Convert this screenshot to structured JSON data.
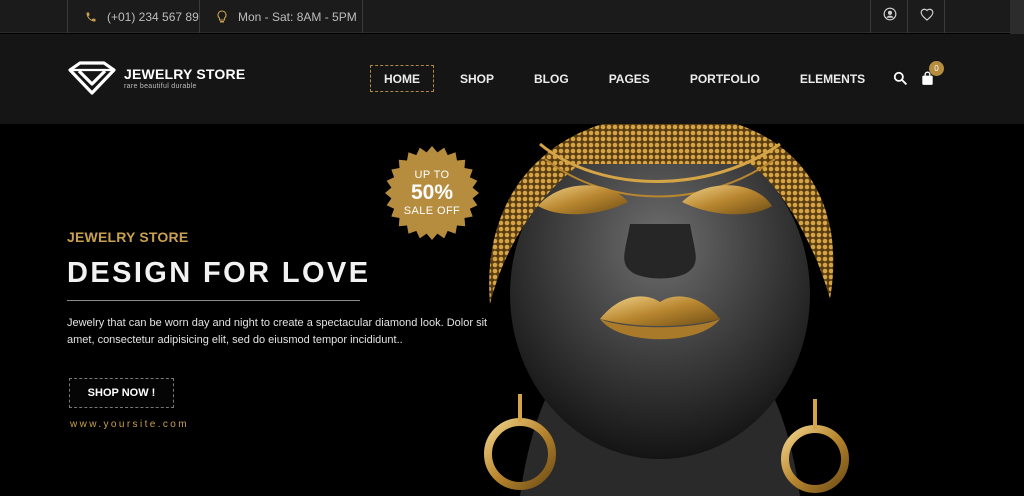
{
  "topbar": {
    "phone": "(+01) 234 567 89",
    "hours": "Mon - Sat: 8AM - 5PM",
    "phone_icon": "phone-icon",
    "hours_icon": "lightbulb-icon",
    "account_icon": "user-icon",
    "wishlist_icon": "heart-icon"
  },
  "brand": {
    "name": "JEWELRY STORE",
    "tagline": "rare beautiful durable",
    "logo_icon": "diamond-logo-icon"
  },
  "nav": {
    "items": [
      {
        "label": "HOME",
        "active": true
      },
      {
        "label": "SHOP",
        "active": false
      },
      {
        "label": "BLOG",
        "active": false
      },
      {
        "label": "PAGES",
        "active": false
      },
      {
        "label": "PORTFOLIO",
        "active": false
      },
      {
        "label": "ELEMENTS",
        "active": false
      }
    ],
    "search_icon": "search-icon",
    "cart_icon": "shopping-bag-icon",
    "cart_count": "0"
  },
  "hero": {
    "badge_top": "UP TO",
    "badge_value": "50%",
    "badge_bottom": "SALE OFF",
    "eyebrow": "JEWELRY STORE",
    "headline": "DESIGN FOR LOVE",
    "description": "Jewelry that can be worn day and night to create a spectacular diamond look. Dolor sit amet, consectetur adipisicing elit, sed do eiusmod tempor incididunt..",
    "cta_label": "SHOP NOW !",
    "site_url": "www.yoursite.com"
  },
  "colors": {
    "accent_gold": "#b68c3f",
    "eyebrow_gold": "#c9a04f",
    "header_bg": "#151515",
    "topbar_bg": "#1b1b1b",
    "hero_bg": "#000000"
  }
}
